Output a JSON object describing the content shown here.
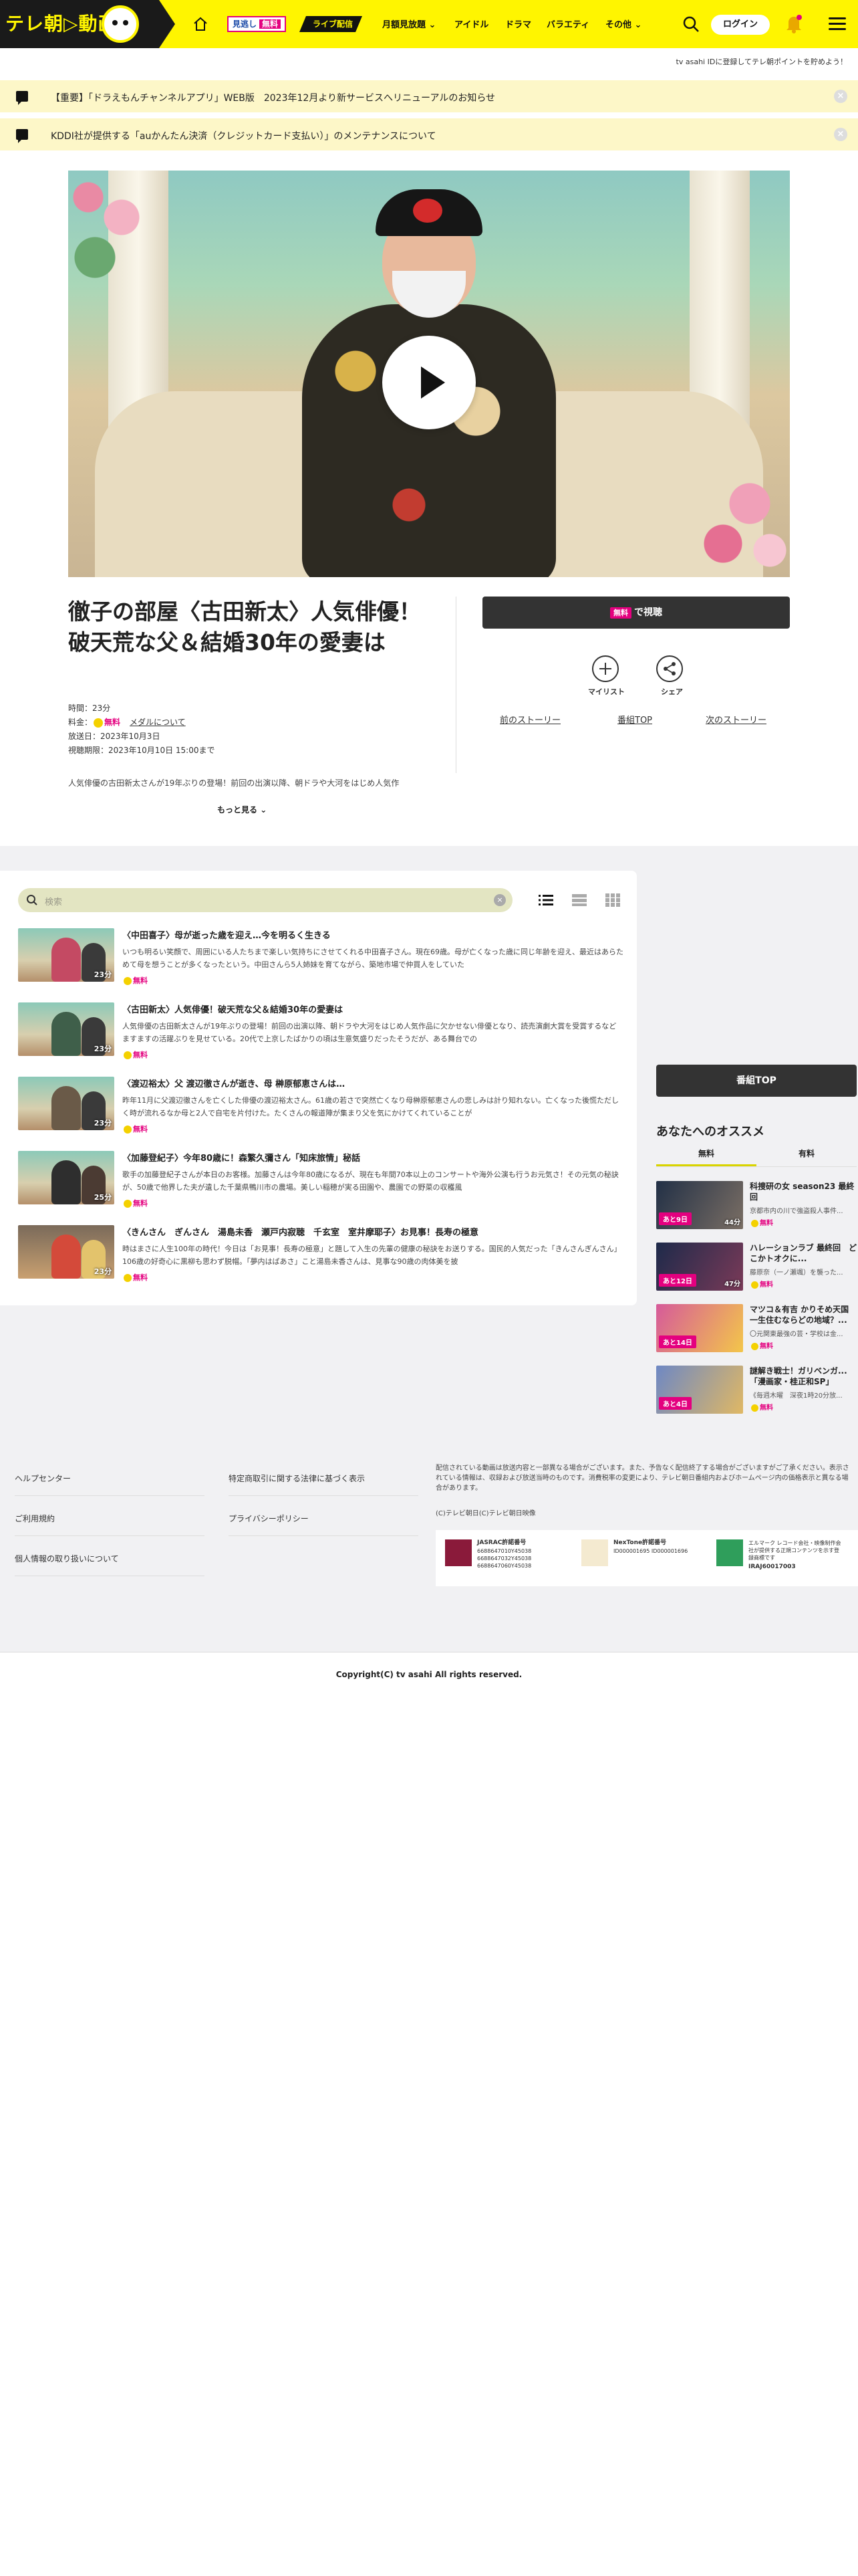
{
  "header": {
    "logo_text": "テレ朝▷動画",
    "pill_free_prefix": "見逃し",
    "pill_free_suffix": "無料",
    "pill_live": "ライブ配信",
    "nav": [
      "月額見放題",
      "アイドル",
      "ドラマ",
      "バラエティ",
      "その他"
    ],
    "login": "ログイン"
  },
  "promo_text": "tv asahi IDに登録してテレ朝ポイントを貯めよう！",
  "notices": [
    "【重要】「ドラえもんチャンネルアプリ」WEB版　2023年12月より新サービスへリニューアルのお知らせ",
    "KDDI社が提供する「auかんたん決済（クレジットカード支払い）」のメンテナンスについて"
  ],
  "episode": {
    "title": "徹子の部屋〈古田新太〉人気俳優！破天荒な父＆結婚30年の愛妻は",
    "duration": "時間：23分",
    "price_label": "料金：",
    "price_free": "無料",
    "medal_link": "メダルについて",
    "aired": "放送日：2023年10月3日",
    "deadline": "視聴期限：2023年10月10日 15:00まで",
    "description": "人気俳優の古田新太さんが19年ぶりの登場！前回の出演以降、朝ドラや大河をはじめ人気作",
    "more": "もっと見る"
  },
  "actions": {
    "watch_badge": "無料",
    "watch_label": "で視聴",
    "mylist": "マイリスト",
    "share": "シェア",
    "prev_story": "前のストーリー",
    "program_top": "番組TOP",
    "next_story": "次のストーリー"
  },
  "list": {
    "search_placeholder": "検索",
    "episodes": [
      {
        "title": "〈中田喜子〉母が逝った歳を迎え…今を明るく生きる",
        "desc": "いつも明るい笑顔で、周囲にいる人たちまで楽しい気持ちにさせてくれる中田喜子さん。現在69歳。母が亡くなった歳に同じ年齢を迎え、最近はあらためて母を想うことが多くなったという。中田さんら5人姉妹を育てながら、築地市場で仲買人をしていた",
        "duration": "23分",
        "free": "無料"
      },
      {
        "title": "〈古田新太〉人気俳優！破天荒な父＆結婚30年の愛妻は",
        "desc": "人気俳優の古田新太さんが19年ぶりの登場！前回の出演以降、朝ドラや大河をはじめ人気作品に欠かせない俳優となり、読売演劇大賞を受賞するなどますますの活躍ぶりを見せている。20代で上京したばかりの頃は生意気盛りだったそうだが、ある舞台での",
        "duration": "23分",
        "free": "無料"
      },
      {
        "title": "〈渡辺裕太〉父 渡辺徹さんが逝き、母 榊原郁恵さんは…",
        "desc": "昨年11月に父渡辺徹さんを亡くした俳優の渡辺裕太さん。61歳の若さで突然亡くなり母榊原郁恵さんの悲しみは計り知れない。亡くなった後慌ただしく時が流れるなか母と2人で自宅を片付けた。たくさんの報道陣が集まり父を気にかけてくれていることが",
        "duration": "23分",
        "free": "無料"
      },
      {
        "title": "〈加藤登紀子〉今年80歳に！森繁久彌さん「知床旅情」秘話",
        "desc": "歌手の加藤登紀子さんが本日のお客様。加藤さんは今年80歳になるが、現在も年間70本以上のコンサートや海外公演も行うお元気さ！その元気の秘訣が、50歳で他界した夫が遺した千葉県鴨川市の農場。美しい稲穂が実る田園や、農園での野菜の収穫風",
        "duration": "25分",
        "free": "無料"
      },
      {
        "title": "〈きんさん　ぎんさん　湯島未香　瀬戸内寂聴　千玄室　室井摩耶子〉お見事！長寿の極意",
        "desc": "時はまさに人生100年の時代！今日は「お見事！長寿の極意」と題して入生の先輩の健康の秘訣をお送りする。国民的人気だった「きんさんぎんさん」106歳の好奇心に黒柳も思わず脱帽。「夢内はばあさ」こと湯島未香さんは、見事な90歳の肉体美を披",
        "duration": "23分",
        "free": "無料"
      }
    ]
  },
  "rail": {
    "program_top": "番組TOP",
    "title": "あなたへのオススメ",
    "tabs": [
      "無料",
      "有料"
    ],
    "items": [
      {
        "badge": "あと9日",
        "duration": "44分",
        "title": "科捜研の女 season23 最終回",
        "sub": "京都市内の川で強盗殺人事件...",
        "free": "無料"
      },
      {
        "badge": "あと12日",
        "duration": "47分",
        "title": "ハレーションラブ 最終回　どこかトオクに...",
        "sub": "藤原奈（一ノ瀬颯）を襲った...",
        "free": "無料"
      },
      {
        "badge": "あと14日",
        "duration": "",
        "title": "マツコ＆有吉 かりそめ天国 一生住むならどの地域？...",
        "sub": "〇元関東最強の芸・学校は金...",
        "free": "無料"
      },
      {
        "badge": "あと4日",
        "duration": "",
        "title": "謎解き戦士！ガリベンガ...「漫画家・桂正和SP」",
        "sub": "《毎週木曜　深夜1時20分放...",
        "free": "無料"
      }
    ]
  },
  "footer": {
    "links_col1": [
      "ヘルプセンター",
      "ご利用規約",
      "個人情報の取り扱いについて"
    ],
    "links_col2": [
      "特定商取引に関する法律に基づく表示",
      "プライバシーポリシー"
    ],
    "note": "配信されている動画は放送内容と一部異なる場合がございます。また、予告なく配信終了する場合がございますがご了承ください。表示されている情報は、収録および放送当時のものです。消費税率の変更により、テレビ朝日番組内およびホームページ内の価格表示と異なる場合があります。",
    "note_copyright": "(C)テレビ朝日(C)テレビ朝日映像",
    "certs": [
      {
        "label": "JASRAC許諾番号",
        "numbers": "6688647010Y45038 6688647032Y45038 6688647060Y45038"
      },
      {
        "label": "NexTone許諾番号",
        "numbers": "ID000001695 ID000001696"
      },
      {
        "label": "IRAJ60017003",
        "numbers": "エルマーク レコード会社・映像制作会社が提供する正規コンテンツを示す登録商標です"
      }
    ],
    "copyright": "Copyright(C) tv asahi All rights reserved."
  },
  "colors": {
    "brand_yellow": "#fff500",
    "free_pink": "#e4007f",
    "dark": "#333333"
  }
}
